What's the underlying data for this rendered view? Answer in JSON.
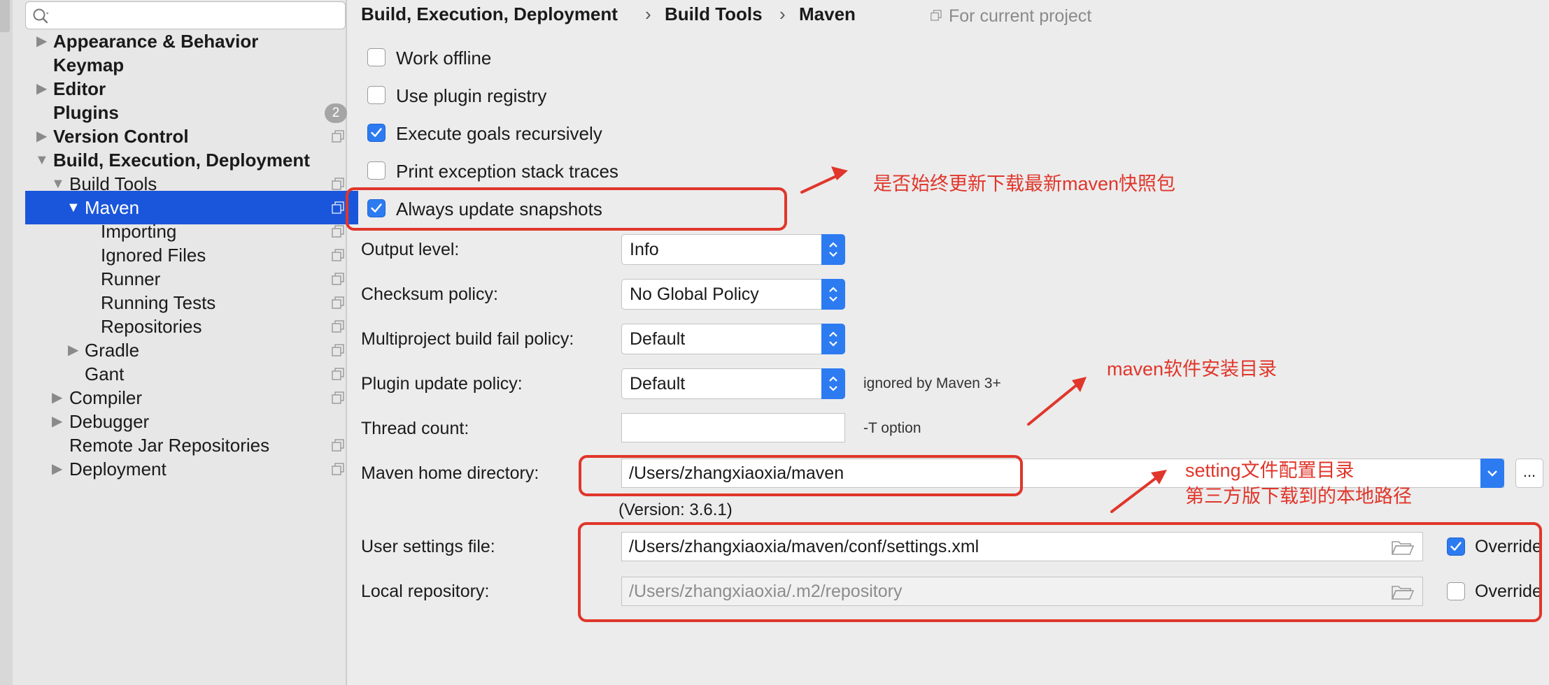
{
  "search": {
    "placeholder": "",
    "value": ""
  },
  "sidebar": {
    "items": [
      {
        "label": "Appearance & Behavior"
      },
      {
        "label": "Keymap"
      },
      {
        "label": "Editor"
      },
      {
        "label": "Plugins",
        "badge": "2"
      },
      {
        "label": "Version Control"
      },
      {
        "label": "Build, Execution, Deployment"
      },
      {
        "label": "Build Tools"
      },
      {
        "label": "Maven",
        "selected": true
      },
      {
        "label": "Importing"
      },
      {
        "label": "Ignored Files"
      },
      {
        "label": "Runner"
      },
      {
        "label": "Running Tests"
      },
      {
        "label": "Repositories"
      },
      {
        "label": "Gradle"
      },
      {
        "label": "Gant"
      },
      {
        "label": "Compiler"
      },
      {
        "label": "Debugger"
      },
      {
        "label": "Remote Jar Repositories"
      },
      {
        "label": "Deployment"
      }
    ]
  },
  "breadcrumb": {
    "items": [
      "Build, Execution, Deployment",
      "Build Tools",
      "Maven"
    ],
    "separator": "›",
    "project_note": "For current project"
  },
  "options": [
    {
      "label": "Work offline",
      "checked": false
    },
    {
      "label": "Use plugin registry",
      "checked": false
    },
    {
      "label": "Execute goals recursively",
      "checked": true
    },
    {
      "label": "Print exception stack traces",
      "checked": false
    },
    {
      "label": "Always update snapshots",
      "checked": true
    }
  ],
  "fields": {
    "output_level": {
      "label": "Output level:",
      "value": "Info"
    },
    "checksum_policy": {
      "label": "Checksum policy:",
      "value": "No Global Policy"
    },
    "multiproject_policy": {
      "label": "Multiproject build fail policy:",
      "value": "Default"
    },
    "plugin_update_policy": {
      "label": "Plugin update policy:",
      "value": "Default",
      "hint": "ignored by Maven 3+"
    },
    "thread_count": {
      "label": "Thread count:",
      "value": "",
      "hint": "-T option"
    },
    "maven_home": {
      "label": "Maven home directory:",
      "value": "/Users/zhangxiaoxia/maven",
      "version": "(Version: 3.6.1)",
      "browse_label": "..."
    },
    "user_settings": {
      "label": "User settings file:",
      "value": "/Users/zhangxiaoxia/maven/conf/settings.xml",
      "override_label": "Override",
      "override_checked": true
    },
    "local_repository": {
      "label": "Local repository:",
      "value": "/Users/zhangxiaoxia/.m2/repository",
      "override_label": "Override",
      "override_checked": false
    }
  },
  "annotations": {
    "snapshots": "是否始终更新下载最新maven快照包",
    "maven_home": "maven软件安装目录",
    "settings_line1": "setting文件配置目录",
    "settings_line2": "第三方版下载到的本地路径"
  },
  "colors": {
    "accent": "#2d7bf1",
    "selection": "#1a56db",
    "annotation": "#e0362b",
    "badge": "#a5a5a5"
  }
}
